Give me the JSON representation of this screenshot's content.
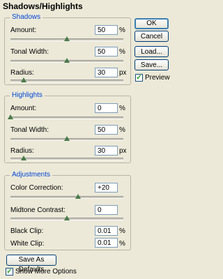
{
  "window": {
    "title": "Shadows/Highlights"
  },
  "shadows": {
    "title": "Shadows",
    "amount_label": "Amount:",
    "amount_value": "50",
    "amount_unit": "%",
    "amount_level": 0.5,
    "tonal_label": "Tonal Width:",
    "tonal_value": "50",
    "tonal_unit": "%",
    "tonal_level": 0.5,
    "radius_label": "Radius:",
    "radius_value": "30",
    "radius_unit": "px",
    "radius_level": 0.12
  },
  "highlights": {
    "title": "Highlights",
    "amount_label": "Amount:",
    "amount_value": "0",
    "amount_unit": "%",
    "amount_level": 0.0,
    "tonal_label": "Tonal Width:",
    "tonal_value": "50",
    "tonal_unit": "%",
    "tonal_level": 0.5,
    "radius_label": "Radius:",
    "radius_value": "30",
    "radius_unit": "px",
    "radius_level": 0.12
  },
  "adjustments": {
    "title": "Adjustments",
    "color_label": "Color Correction:",
    "color_value": "+20",
    "color_level": 0.6,
    "midtone_label": "Midtone Contrast:",
    "midtone_value": "0",
    "midtone_level": 0.5,
    "black_label": "Black Clip:",
    "black_value": "0.01",
    "black_unit": "%",
    "white_label": "White Clip:",
    "white_value": "0.01",
    "white_unit": "%"
  },
  "buttons": {
    "ok": "OK",
    "cancel": "Cancel",
    "load": "Load...",
    "save": "Save...",
    "save_defaults": "Save As Defaults"
  },
  "preview": {
    "label": "Preview",
    "checked": true
  },
  "more_options": {
    "label": "Show More Options",
    "checked": true
  },
  "colors": {
    "group_title": "#0046d5",
    "thumb": "#4a7a4a"
  }
}
